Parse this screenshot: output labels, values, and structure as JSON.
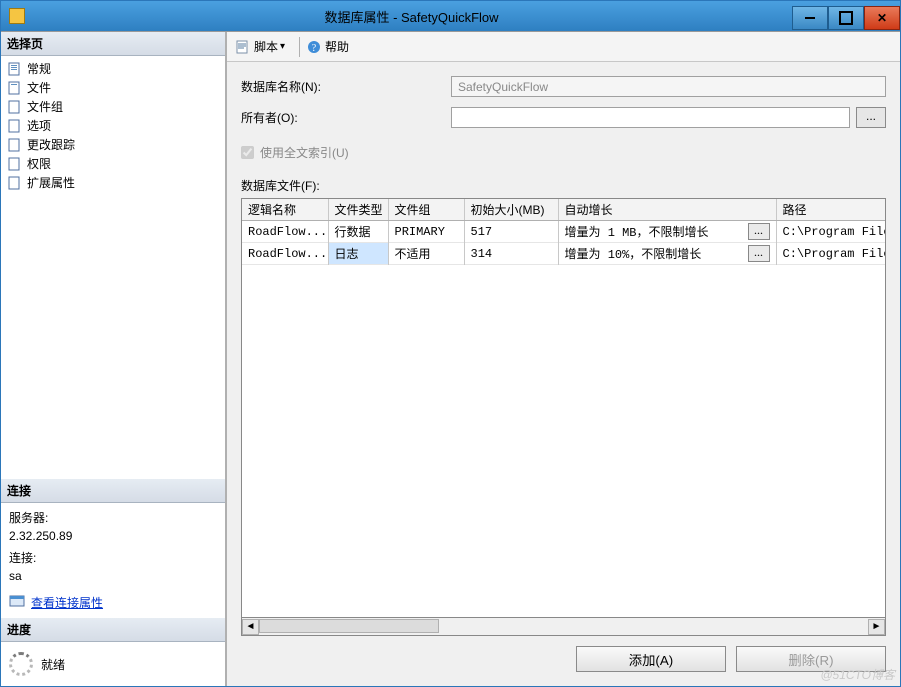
{
  "title": "数据库属性 - SafetyQuickFlow",
  "sidebar": {
    "section_select": "选择页",
    "items": [
      {
        "label": "常规"
      },
      {
        "label": "文件"
      },
      {
        "label": "文件组"
      },
      {
        "label": "选项"
      },
      {
        "label": "更改跟踪"
      },
      {
        "label": "权限"
      },
      {
        "label": "扩展属性"
      }
    ],
    "section_conn": "连接",
    "server_label": "服务器:",
    "server_value": "2.32.250.89",
    "conn_label": "连接:",
    "conn_value": "sa",
    "view_conn": "查看连接属性",
    "section_prog": "进度",
    "prog_status": "就绪"
  },
  "toolbar": {
    "script": "脚本",
    "help": "帮助"
  },
  "form": {
    "dbname_label": "数据库名称(N):",
    "dbname_value": "SafetyQuickFlow",
    "owner_label": "所有者(O):",
    "owner_value": "",
    "browse": "...",
    "fulltext_label": "使用全文索引(U)",
    "files_label": "数据库文件(F):"
  },
  "table": {
    "headers": {
      "logical": "逻辑名称",
      "ftype": "文件类型",
      "fgroup": "文件组",
      "initsize": "初始大小(MB)",
      "growth": "自动增长",
      "path": "路径"
    },
    "rows": [
      {
        "logical": "RoadFlow...",
        "ftype": "行数据",
        "fgroup": "PRIMARY",
        "initsize": "517",
        "growth": "增量为 1 MB，不限制增长",
        "path": "C:\\Program Files\\Micr"
      },
      {
        "logical": "RoadFlow...",
        "ftype": "日志",
        "fgroup": "不适用",
        "initsize": "314",
        "growth": "增量为 10%，不限制增长",
        "path": "C:\\Program Files\\Micr"
      }
    ]
  },
  "buttons": {
    "add": "添加(A)",
    "remove": "删除(R)"
  },
  "watermark": "@51CTO博客"
}
